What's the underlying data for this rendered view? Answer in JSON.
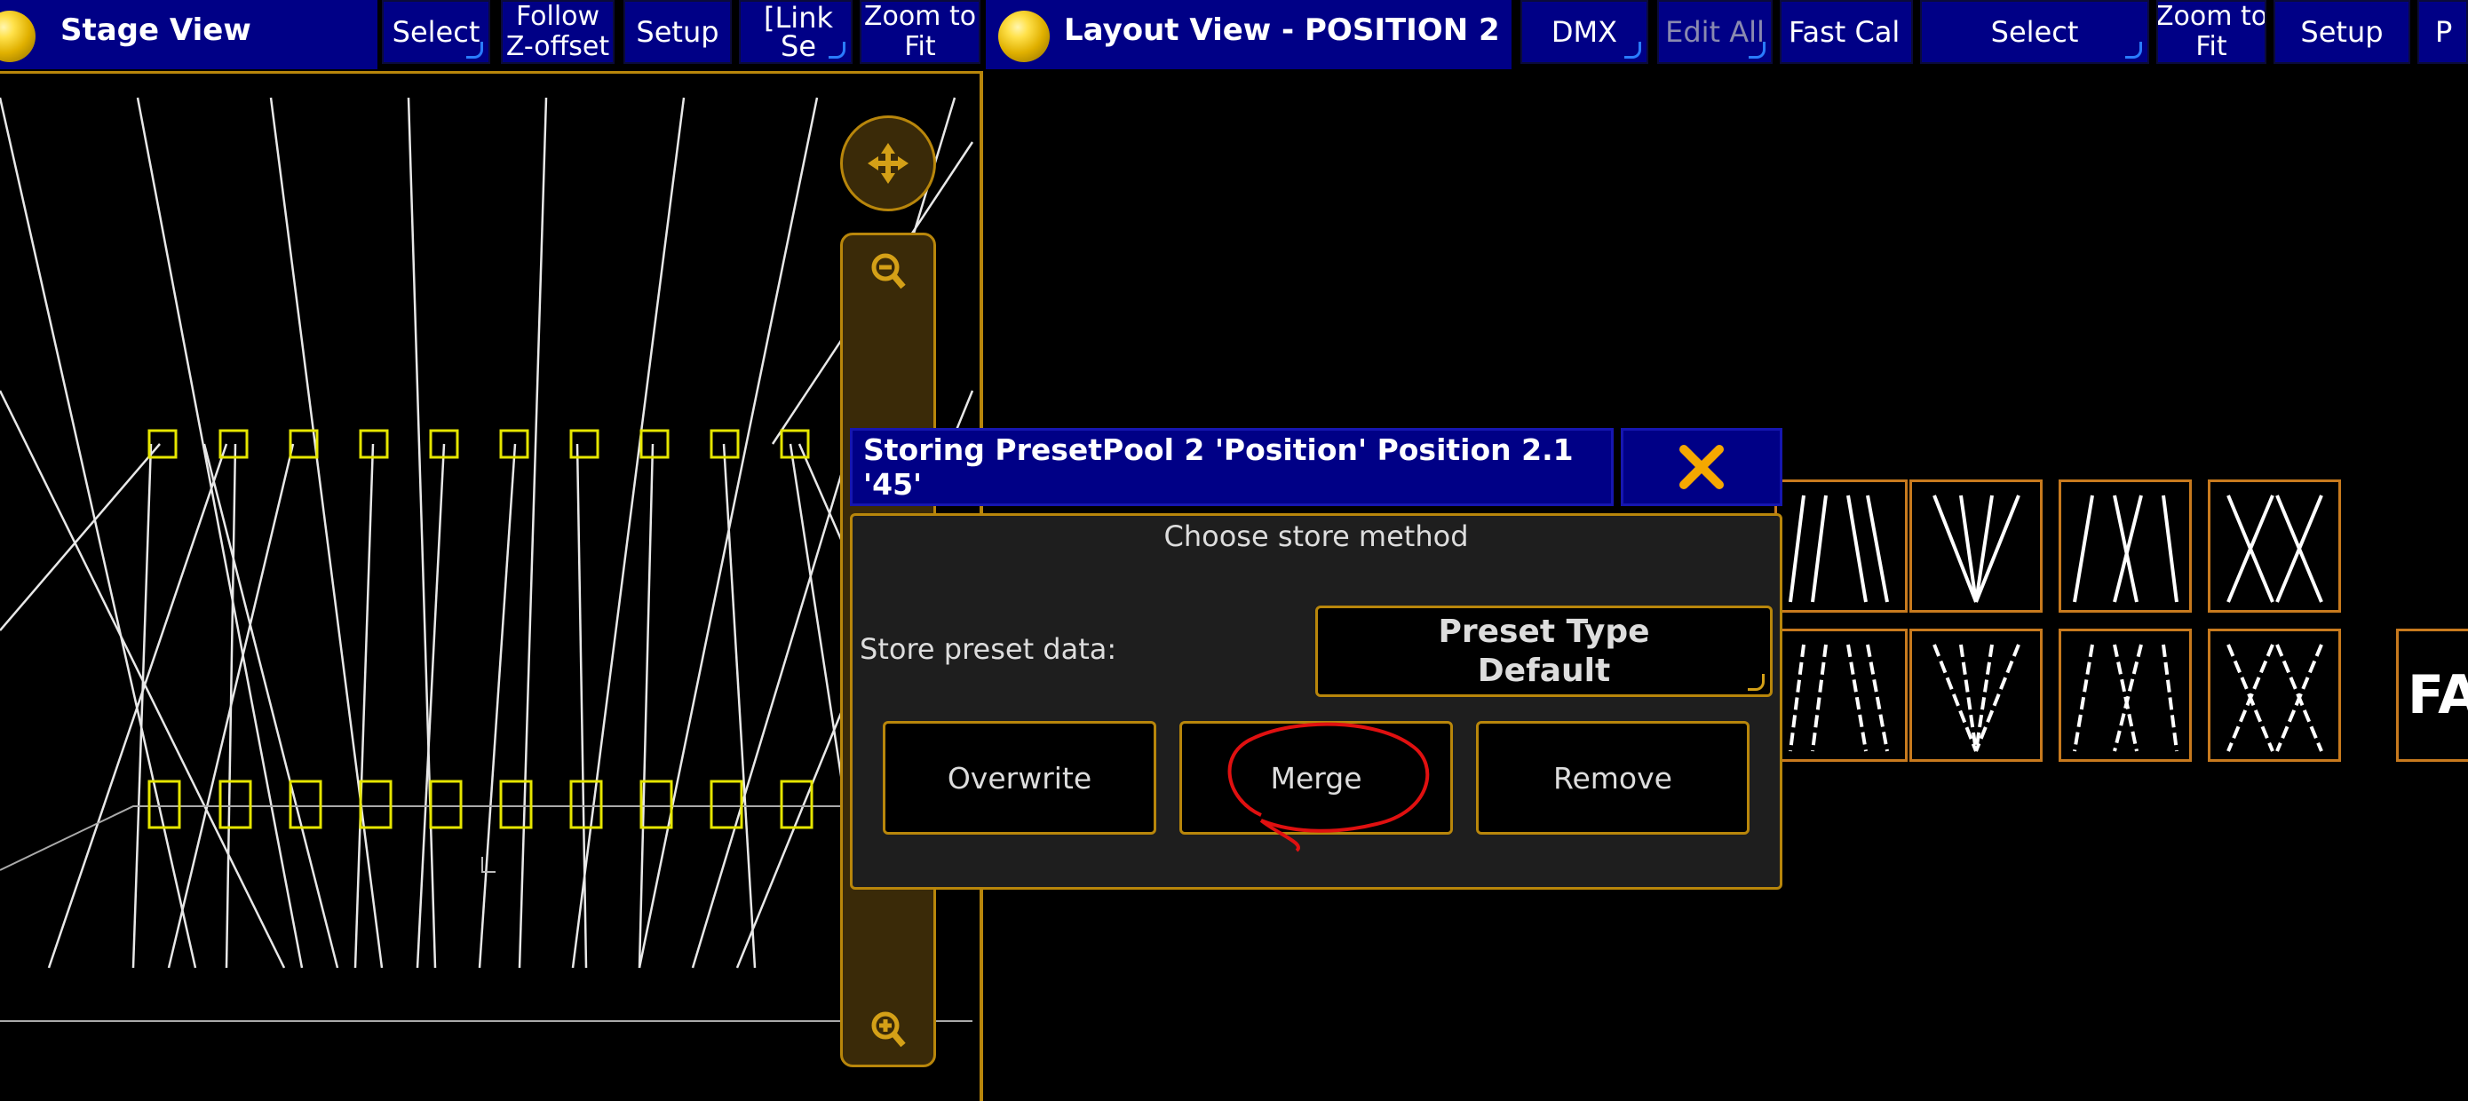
{
  "stage_view": {
    "title": "Stage View",
    "buttons": [
      {
        "label": "Select"
      },
      {
        "label": "Follow\nZ-offset"
      },
      {
        "label": "Setup"
      },
      {
        "label": "[Link Se"
      },
      {
        "label": "Zoom to\nFit"
      }
    ]
  },
  "layout_view": {
    "title": "Layout View - POSITION 2",
    "buttons": [
      {
        "label": "DMX"
      },
      {
        "label": "Edit All"
      },
      {
        "label": "Fast Cal"
      },
      {
        "label": "Select"
      },
      {
        "label": "Zoom to\nFit"
      },
      {
        "label": "Setup"
      },
      {
        "label": "P"
      }
    ],
    "partial_tile_label": "FA"
  },
  "dialog": {
    "title": "Storing PresetPool 2 'Position' Position 2.1 '45'",
    "subtitle": "Choose store method",
    "store_label": "Store preset data:",
    "preset_type_line1": "Preset Type",
    "preset_type_line2": "Default",
    "overwrite_label": "Overwrite",
    "merge_label": "Merge",
    "remove_label": "Remove"
  },
  "colors": {
    "title_bar": "#000086",
    "accent_border": "#b8860b",
    "annotation": "#e01010",
    "fixture": "#e6e600"
  }
}
